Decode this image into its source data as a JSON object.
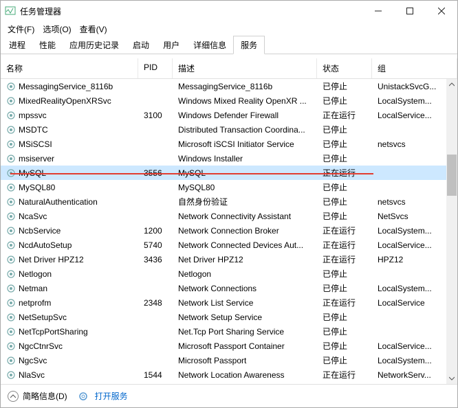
{
  "window": {
    "title": "任务管理器"
  },
  "menu": {
    "file": "文件(F)",
    "options": "选项(O)",
    "view": "查看(V)"
  },
  "tabs": {
    "items": [
      "进程",
      "性能",
      "应用历史记录",
      "启动",
      "用户",
      "详细信息",
      "服务"
    ],
    "active_index": 6
  },
  "columns": {
    "name": "名称",
    "pid": "PID",
    "desc": "描述",
    "status": "状态",
    "group": "组"
  },
  "status_labels": {
    "stopped": "已停止",
    "running": "正在运行"
  },
  "services": [
    {
      "name": "MessagingService_8116b",
      "pid": "",
      "desc": "MessagingService_8116b",
      "status": "已停止",
      "group": "UnistackSvcG..."
    },
    {
      "name": "MixedRealityOpenXRSvc",
      "pid": "",
      "desc": "Windows Mixed Reality OpenXR ...",
      "status": "已停止",
      "group": "LocalSystem..."
    },
    {
      "name": "mpssvc",
      "pid": "3100",
      "desc": "Windows Defender Firewall",
      "status": "正在运行",
      "group": "LocalService..."
    },
    {
      "name": "MSDTC",
      "pid": "",
      "desc": "Distributed Transaction Coordina...",
      "status": "已停止",
      "group": ""
    },
    {
      "name": "MSiSCSI",
      "pid": "",
      "desc": "Microsoft iSCSI Initiator Service",
      "status": "已停止",
      "group": "netsvcs"
    },
    {
      "name": "msiserver",
      "pid": "",
      "desc": "Windows Installer",
      "status": "已停止",
      "group": ""
    },
    {
      "name": "MySQL",
      "pid": "3556",
      "desc": "MySQL",
      "status": "正在运行",
      "group": "",
      "selected": true
    },
    {
      "name": "MySQL80",
      "pid": "",
      "desc": "MySQL80",
      "status": "已停止",
      "group": ""
    },
    {
      "name": "NaturalAuthentication",
      "pid": "",
      "desc": "自然身份验证",
      "status": "已停止",
      "group": "netsvcs"
    },
    {
      "name": "NcaSvc",
      "pid": "",
      "desc": "Network Connectivity Assistant",
      "status": "已停止",
      "group": "NetSvcs"
    },
    {
      "name": "NcbService",
      "pid": "1200",
      "desc": "Network Connection Broker",
      "status": "正在运行",
      "group": "LocalSystem..."
    },
    {
      "name": "NcdAutoSetup",
      "pid": "5740",
      "desc": "Network Connected Devices Aut...",
      "status": "正在运行",
      "group": "LocalService..."
    },
    {
      "name": "Net Driver HPZ12",
      "pid": "3436",
      "desc": "Net Driver HPZ12",
      "status": "正在运行",
      "group": "HPZ12"
    },
    {
      "name": "Netlogon",
      "pid": "",
      "desc": "Netlogon",
      "status": "已停止",
      "group": ""
    },
    {
      "name": "Netman",
      "pid": "",
      "desc": "Network Connections",
      "status": "已停止",
      "group": "LocalSystem..."
    },
    {
      "name": "netprofm",
      "pid": "2348",
      "desc": "Network List Service",
      "status": "正在运行",
      "group": "LocalService"
    },
    {
      "name": "NetSetupSvc",
      "pid": "",
      "desc": "Network Setup Service",
      "status": "已停止",
      "group": ""
    },
    {
      "name": "NetTcpPortSharing",
      "pid": "",
      "desc": "Net.Tcp Port Sharing Service",
      "status": "已停止",
      "group": ""
    },
    {
      "name": "NgcCtnrSvc",
      "pid": "",
      "desc": "Microsoft Passport Container",
      "status": "已停止",
      "group": "LocalService..."
    },
    {
      "name": "NgcSvc",
      "pid": "",
      "desc": "Microsoft Passport",
      "status": "已停止",
      "group": "LocalSystem..."
    },
    {
      "name": "NlaSvc",
      "pid": "1544",
      "desc": "Network Location Awareness",
      "status": "正在运行",
      "group": "NetworkServ..."
    }
  ],
  "footer": {
    "fewer": "简略信息(D)",
    "openServices": "打开服务"
  }
}
